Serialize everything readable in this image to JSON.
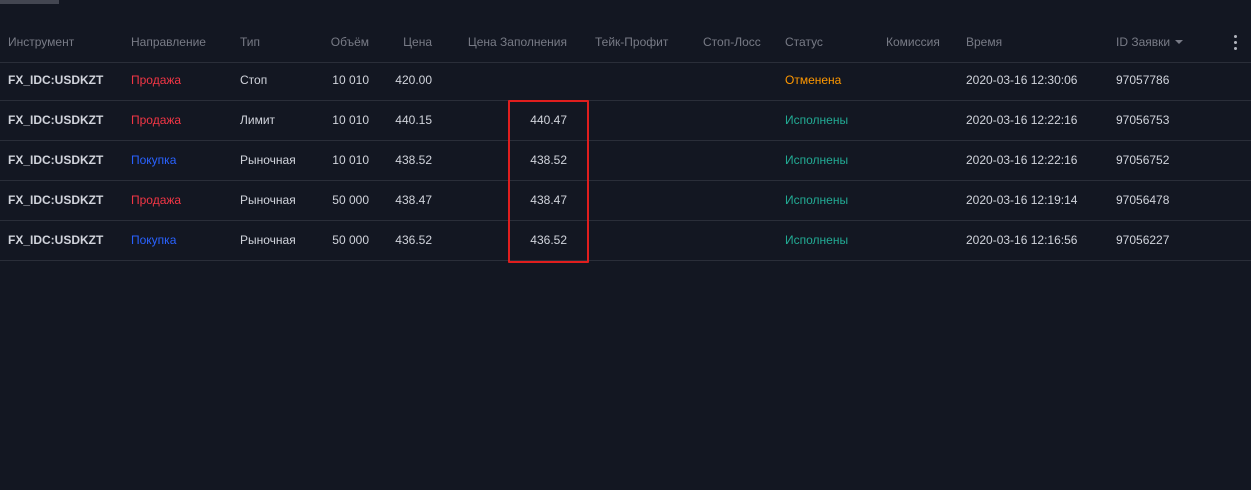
{
  "colors": {
    "background": "#131722",
    "sell": "#f23645",
    "buy": "#2962ff",
    "filled": "#22ab94",
    "cancelled": "#ff9800",
    "highlight": "#e01e1e"
  },
  "table": {
    "headers": {
      "instrument": "Инструмент",
      "direction": "Направление",
      "type": "Тип",
      "volume": "Объём",
      "price": "Цена",
      "fill_price": "Цена Заполнения",
      "take_profit": "Тейк-Профит",
      "stop_loss": "Стоп-Лосс",
      "status": "Статус",
      "commission": "Комиссия",
      "time": "Время",
      "order_id": "ID Заявки"
    },
    "rows": [
      {
        "instrument": "FX_IDC:USDKZT",
        "direction": "Продажа",
        "direction_kind": "sell",
        "type": "Стоп",
        "volume": "10 010",
        "price": "420.00",
        "fill_price": "",
        "take_profit": "",
        "stop_loss": "",
        "status": "Отменена",
        "status_kind": "cancelled",
        "commission": "",
        "time": "2020-03-16 12:30:06",
        "order_id": "97057786"
      },
      {
        "instrument": "FX_IDC:USDKZT",
        "direction": "Продажа",
        "direction_kind": "sell",
        "type": "Лимит",
        "volume": "10 010",
        "price": "440.15",
        "fill_price": "440.47",
        "take_profit": "",
        "stop_loss": "",
        "status": "Исполнены",
        "status_kind": "filled",
        "commission": "",
        "time": "2020-03-16 12:22:16",
        "order_id": "97056753"
      },
      {
        "instrument": "FX_IDC:USDKZT",
        "direction": "Покупка",
        "direction_kind": "buy",
        "type": "Рыночная",
        "volume": "10 010",
        "price": "438.52",
        "fill_price": "438.52",
        "take_profit": "",
        "stop_loss": "",
        "status": "Исполнены",
        "status_kind": "filled",
        "commission": "",
        "time": "2020-03-16 12:22:16",
        "order_id": "97056752"
      },
      {
        "instrument": "FX_IDC:USDKZT",
        "direction": "Продажа",
        "direction_kind": "sell",
        "type": "Рыночная",
        "volume": "50 000",
        "price": "438.47",
        "fill_price": "438.47",
        "take_profit": "",
        "stop_loss": "",
        "status": "Исполнены",
        "status_kind": "filled",
        "commission": "",
        "time": "2020-03-16 12:19:14",
        "order_id": "97056478"
      },
      {
        "instrument": "FX_IDC:USDKZT",
        "direction": "Покупка",
        "direction_kind": "buy",
        "type": "Рыночная",
        "volume": "50 000",
        "price": "436.52",
        "fill_price": "436.52",
        "take_profit": "",
        "stop_loss": "",
        "status": "Исполнены",
        "status_kind": "filled",
        "commission": "",
        "time": "2020-03-16 12:16:56",
        "order_id": "97056227"
      }
    ]
  },
  "icons": {
    "menu": "more-vertical-icon",
    "sort": "sort-descending-icon"
  }
}
